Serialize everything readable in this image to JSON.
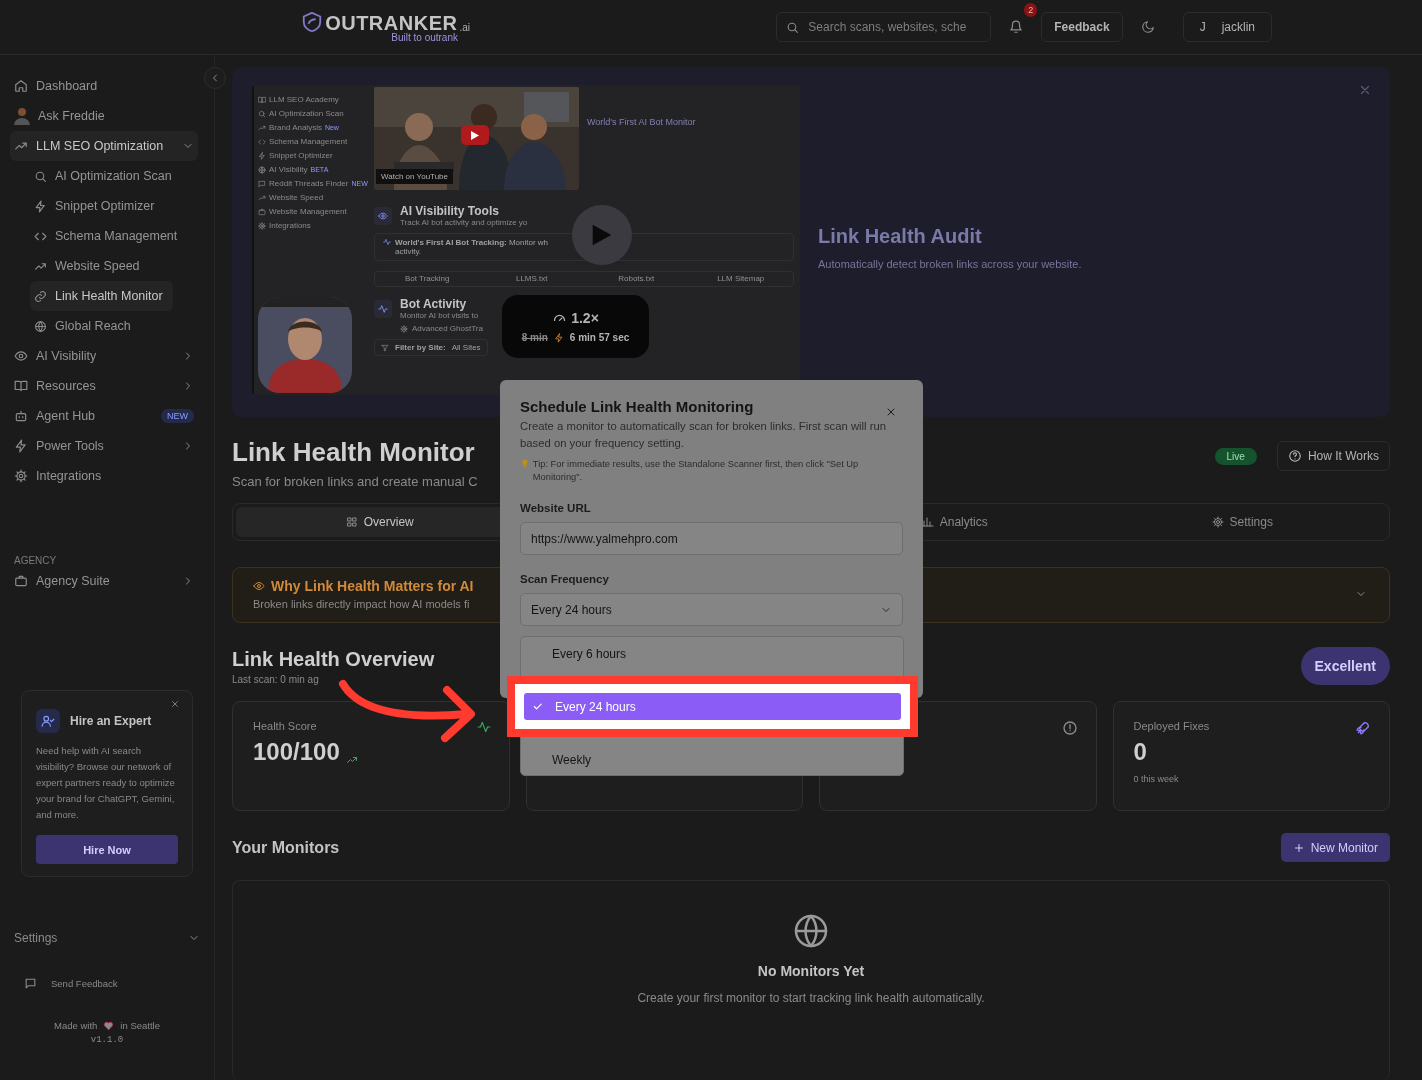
{
  "header": {
    "logo": "OUTRANKER",
    "logo_suffix": ".ai",
    "tagline": "Built to outrank",
    "search": {
      "placeholder": "Search scans, websites, sche"
    },
    "notifications": "2",
    "feedback": "Feedback",
    "avatar": "J",
    "user": "jacklin"
  },
  "sidebar": {
    "nav": [
      {
        "label": "Dashboard",
        "selected": false
      },
      {
        "label": "Ask Freddie",
        "selected": false
      },
      {
        "label": "LLM SEO Optimization",
        "selected": true,
        "expanded": true,
        "children": [
          {
            "label": "AI Optimization Scan",
            "selected": false
          },
          {
            "label": "Snippet Optimizer",
            "selected": false
          },
          {
            "label": "Schema Management",
            "selected": false
          },
          {
            "label": "Website Speed",
            "selected": false
          },
          {
            "label": "Link Health Monitor",
            "selected": true
          },
          {
            "label": "Global Reach",
            "selected": false
          }
        ]
      },
      {
        "label": "AI Visibility",
        "selected": false,
        "expanded": false
      },
      {
        "label": "Resources",
        "selected": false,
        "expanded": false
      },
      {
        "label": "Agent Hub",
        "selected": false,
        "badge": "NEW"
      },
      {
        "label": "Power Tools",
        "selected": false,
        "expanded": false
      },
      {
        "label": "Integrations",
        "selected": false
      }
    ],
    "agency": {
      "heading": "AGENCY",
      "items": [
        {
          "label": "Agency Suite",
          "selected": false,
          "expanded": false
        }
      ]
    },
    "promo": {
      "title": "Hire an Expert",
      "text": "Need help with AI search visibility? Browse our network of expert partners ready to optimize your brand for ChatGPT, Gemini, and more.",
      "button": "Hire Now"
    },
    "settings": "Settings",
    "send_feedback": "Send Feedback",
    "made_with": "Made with",
    "location": "in Seattle",
    "version": "v1.1.0"
  },
  "video": {
    "mini_nav": [
      {
        "label": "LLM SEO Academy"
      },
      {
        "label": "AI Optimization Scan"
      },
      {
        "label": "Brand Analysis",
        "badge": "New"
      },
      {
        "label": "Schema Management"
      },
      {
        "label": "Snippet Optimizer"
      },
      {
        "label": "AI Visibility",
        "badge": "BETA"
      },
      {
        "label": "Reddit Threads Finder",
        "badge": "NEW"
      },
      {
        "label": "Website Speed"
      },
      {
        "label": "Website Management"
      },
      {
        "label": "Integrations"
      }
    ],
    "watch_on": "Watch on",
    "youtube": "YouTube",
    "youtube_title": "World's First AI Bot Monitor",
    "tools_title": "AI Visibility Tools",
    "tools_subtitle": "Track AI bot activity and optimize yo",
    "note": "**World's First AI Bot Tracking:** Monitor wh",
    "note_end": "activity.",
    "tabs": [
      "Bot Tracking",
      "LLMS.txt",
      "Robots.txt",
      "LLM Sitemap"
    ],
    "bot_title": "Bot Activity",
    "bot_subtitle": "Monitor AI bot visits to",
    "ghost": "Advanced GhostTra",
    "filter_label": "Filter by Site:",
    "filter_value": "All Sites",
    "speed": "1.2×",
    "old_time": "8 min",
    "new_time": "6 min 57 sec"
  },
  "banner": {
    "title": "Link Health Audit",
    "subtitle": "Automatically detect broken links across your website."
  },
  "page": {
    "title": "Link Health Monitor",
    "subtitle": "Scan for broken links and create manual C",
    "live": "Live",
    "how": "How It Works",
    "tabs": [
      {
        "label": "Overview",
        "selected": true
      },
      {
        "label": "Analytics",
        "selected": false
      },
      {
        "label": "Settings",
        "selected": false
      }
    ],
    "info": {
      "title": "Why Link Health Matters for AI",
      "text": "Broken links directly impact how AI models fi"
    },
    "overview": {
      "title": "Link Health Overview",
      "last_scan": "Last scan: 0 min ag",
      "rating": "Excellent"
    },
    "health": {
      "label": "Health Score",
      "value": "100/100"
    },
    "fixes": {
      "label": "Deployed Fixes",
      "value": "0",
      "note": "0 this week"
    },
    "monitors": {
      "title": "Your Monitors",
      "new_button": "New Monitor",
      "empty_title": "No Monitors Yet",
      "empty_text": "Create your first monitor to start tracking link health automatically."
    }
  },
  "modal": {
    "title": "Schedule Link Health Monitoring",
    "description": "Create a monitor to automatically scan for broken links. First scan will run based on your frequency setting.",
    "tip": "Tip: For immediate results, use the Standalone Scanner first, then click \"Set Up Monitoring\".",
    "url_label": "Website URL",
    "url": "https://www.yalmehpro.com",
    "frequency_label": "Scan Frequency",
    "frequency": "Every 24 hours",
    "options": [
      {
        "label": "Every 6 hours",
        "selected": false
      },
      {
        "label": "Every 24 hours",
        "selected": true
      },
      {
        "label": "Weekly",
        "selected": false
      }
    ]
  }
}
